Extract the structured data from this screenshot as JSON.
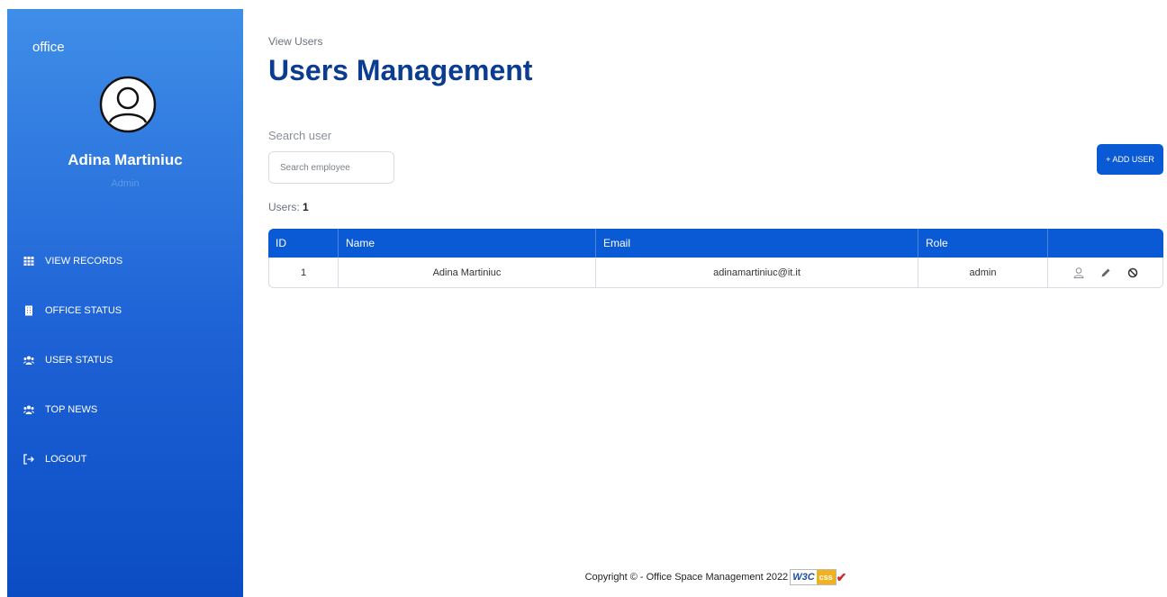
{
  "sidebar": {
    "brand": "office",
    "user_name": "Adina Martiniuc",
    "user_role": "Admin",
    "items": [
      {
        "label": "VIEW RECORDS",
        "icon": "table-icon"
      },
      {
        "label": "OFFICE STATUS",
        "icon": "building-icon"
      },
      {
        "label": "USER STATUS",
        "icon": "users-icon"
      },
      {
        "label": "TOP NEWS",
        "icon": "users-icon"
      },
      {
        "label": "LOGOUT",
        "icon": "logout-icon"
      }
    ]
  },
  "main": {
    "breadcrumb": "View Users",
    "title": "Users Management",
    "search_label": "Search user",
    "search_placeholder": "Search employee",
    "search_value": "",
    "add_button": "+ ADD USER",
    "users_label": "Users:",
    "users_count": "1",
    "table": {
      "columns": [
        "ID",
        "Name",
        "Email",
        "Role",
        ""
      ],
      "rows": [
        {
          "id": "1",
          "name": "Adina Martiniuc",
          "email": "adinamartiniuc@it.it",
          "role": "admin"
        }
      ]
    }
  },
  "footer": {
    "text": "Copyright © - Office Space Management 2022",
    "badge_left": "W3C",
    "badge_right": "css"
  },
  "colors": {
    "accent": "#0a5ad6",
    "title": "#0a3d91",
    "sidebar_top": "#3f8ee8",
    "sidebar_bottom": "#0b4cc2"
  }
}
